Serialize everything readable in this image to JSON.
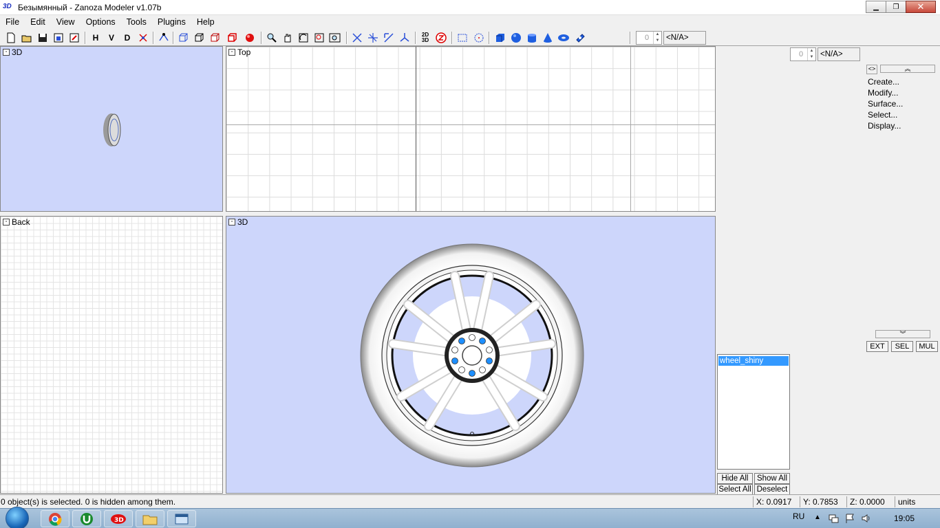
{
  "window": {
    "title": "Безымянный - Zanoza Modeler v1.07b",
    "app_icon": "3D"
  },
  "menu": [
    "File",
    "Edit",
    "View",
    "Options",
    "Tools",
    "Plugins",
    "Help"
  ],
  "toolbar": {
    "letters": [
      "H",
      "V",
      "D"
    ],
    "spinner_value": "0",
    "na_label": "<N/A>",
    "icons": [
      "new-file-icon",
      "open-folder-icon",
      "save-icon",
      "save-as-icon",
      "export-icon",
      "h-view-icon",
      "v-view-icon",
      "d-view-icon",
      "transform-icon",
      "vertex-icon",
      "cube-wire-icon",
      "cube-solid-icon",
      "cube-shaded-icon",
      "cube-red-icon",
      "render-sphere-icon",
      "zoom-icon",
      "pan-hand-icon",
      "rotate-view-icon",
      "zoom-region-icon",
      "zoom-all-icon",
      "move-icon",
      "rotate-icon",
      "scale-icon",
      "axis-icon",
      "2d-3d-icon",
      "z-icon",
      "rect-select-icon",
      "circle-select-icon",
      "box-primitive-icon",
      "sphere-primitive-icon",
      "cylinder-primitive-icon",
      "cone-primitive-icon",
      "torus-primitive-icon",
      "capsule-primitive-icon"
    ]
  },
  "viewports": {
    "top_left": {
      "label": "3D"
    },
    "top_right": {
      "label": "Top"
    },
    "bottom_left": {
      "label": "Back"
    },
    "bottom_right": {
      "label": "3D"
    }
  },
  "right_panel": {
    "spinner_value": "0",
    "na_label": "<N/A>",
    "commands": [
      "Create...",
      "Modify...",
      "Surface...",
      "Select...",
      "Display..."
    ],
    "mode_buttons": [
      "EXT",
      "SEL",
      "MUL"
    ],
    "objects": [
      "wheel_shiny"
    ],
    "list_buttons": {
      "hide_all": "Hide All",
      "show_all": "Show All",
      "select_all": "Select All",
      "deselect": "Deselect"
    }
  },
  "status": {
    "message": "0 object(s) is selected. 0 is hidden among them.",
    "x": "X: 0.0917",
    "y": "Y: 0.7853",
    "z": "Z: 0.0000",
    "units": "units"
  },
  "taskbar": {
    "apps": [
      "chrome-icon",
      "utorrent-icon",
      "zanoza-3d-icon",
      "explorer-folder-icon",
      "window-app-icon"
    ],
    "language": "RU",
    "time": "19:05"
  }
}
